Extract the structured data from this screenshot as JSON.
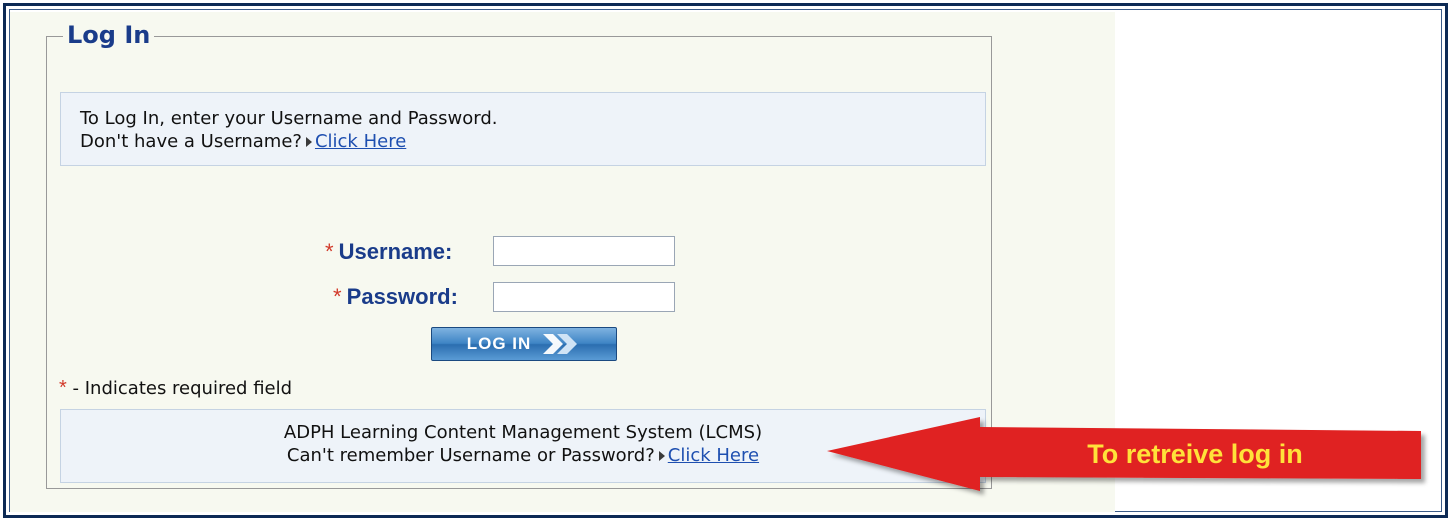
{
  "login": {
    "legend": "Log In",
    "intro_line1": "To Log In, enter your Username and Password.",
    "intro_line2": "Don't have a Username?",
    "register_link": "Click Here",
    "username_label": "Username:",
    "password_label": "Password:",
    "required_marker": "*",
    "username_value": "",
    "password_value": "",
    "login_button": "LOG IN",
    "required_note": "- Indicates required field",
    "system_name": "ADPH Learning Content Management System (LCMS)",
    "forgot_text": "Can't remember Username or Password?",
    "forgot_link": "Click Here"
  },
  "annotation": {
    "text": "To retreive log in",
    "arrow_color": "#e02020",
    "text_color": "#ffe23a"
  },
  "colors": {
    "frame": "#0d2a55",
    "panel": "#f7f9f0",
    "label": "#1a3c8a",
    "required": "#d23a2a",
    "link": "#1e4fb0"
  }
}
